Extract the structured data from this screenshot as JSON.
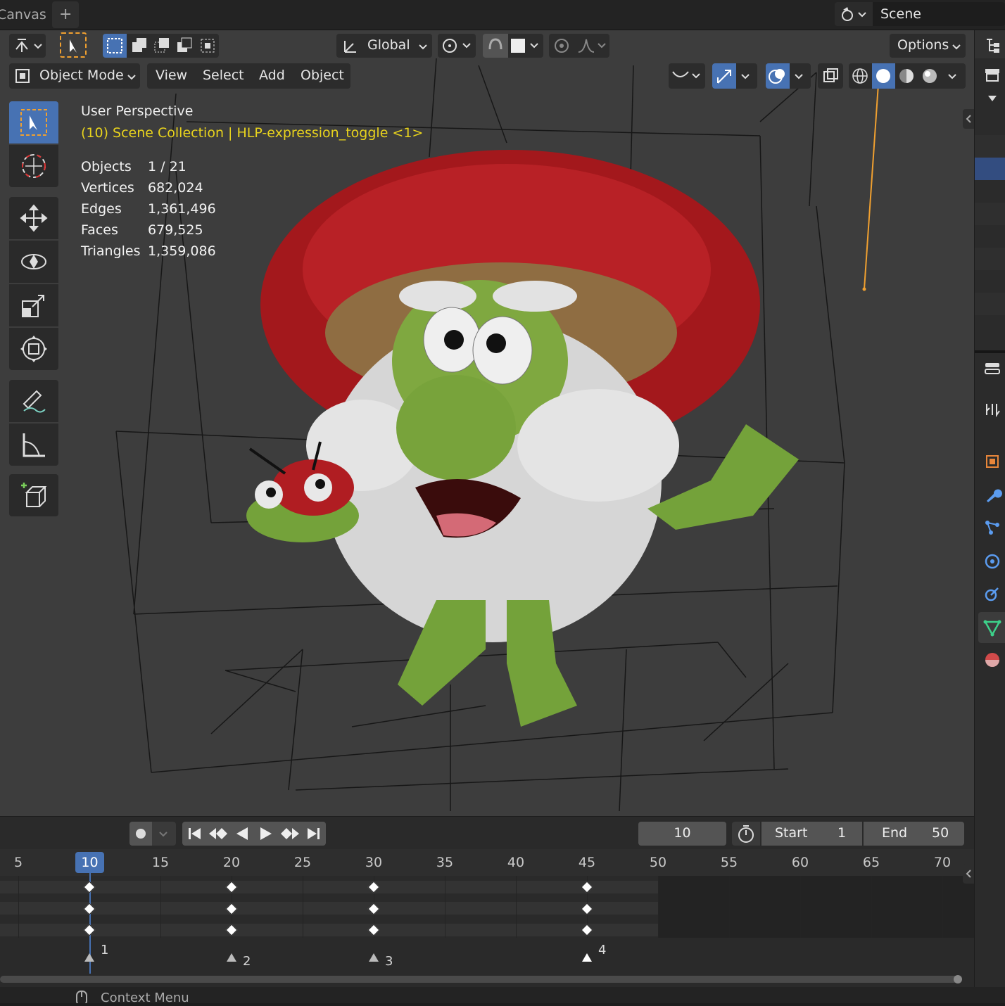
{
  "topbar": {
    "tab_label": "Canvas",
    "add_tab": "+",
    "scene_label": "Scene"
  },
  "toolbar": {
    "transform_orientation": "Global",
    "options_label": "Options"
  },
  "header": {
    "mode_label": "Object Mode",
    "menus": [
      "View",
      "Select",
      "Add",
      "Object"
    ]
  },
  "overlay": {
    "perspective": "User Perspective",
    "collection": "(10) Scene Collection | HLP-expression_toggle <1>",
    "stats": [
      {
        "label": "Objects",
        "value": "1 / 21"
      },
      {
        "label": "Vertices",
        "value": "682,024"
      },
      {
        "label": "Edges",
        "value": "1,361,496"
      },
      {
        "label": "Faces",
        "value": "679,525"
      },
      {
        "label": "Triangles",
        "value": "1,359,086"
      }
    ]
  },
  "timeline": {
    "current_frame": "10",
    "start_label": "Start",
    "start_value": "1",
    "end_label": "End",
    "end_value": "50",
    "ruler": [
      "5",
      "10",
      "15",
      "20",
      "25",
      "30",
      "35",
      "40",
      "45",
      "50",
      "55",
      "60",
      "65",
      "70"
    ],
    "keyframe_frames": [
      10,
      20,
      30,
      45
    ],
    "markers": [
      "1",
      "2",
      "3",
      "4"
    ]
  },
  "statusbar": {
    "context_menu": "Context Menu"
  },
  "colors": {
    "active_blue": "#4772b3",
    "header_text_yellow": "#e8d31d",
    "selection_orange": "#f0a030"
  }
}
